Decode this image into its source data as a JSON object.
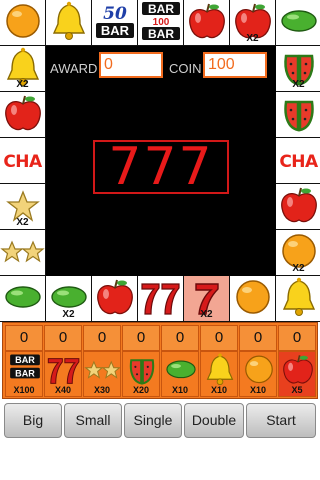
{
  "board": {
    "cells": [
      {
        "id": "c0",
        "icon": "orange",
        "mult": ""
      },
      {
        "id": "c1",
        "icon": "bell",
        "mult": ""
      },
      {
        "id": "c2",
        "icon": "bar-50",
        "mult": "",
        "label_top": "50",
        "label_bottom": "BAR"
      },
      {
        "id": "c3",
        "icon": "bar-100",
        "mult": "",
        "label_top": "BAR",
        "label_mid": "100",
        "label_bottom": "BAR"
      },
      {
        "id": "c4",
        "icon": "apple",
        "mult": ""
      },
      {
        "id": "c5",
        "icon": "apple",
        "mult": "X2"
      },
      {
        "id": "c6",
        "icon": "melon",
        "mult": ""
      },
      {
        "id": "c7",
        "icon": "watermelon",
        "mult": "X2"
      },
      {
        "id": "c8",
        "icon": "watermelon",
        "mult": ""
      },
      {
        "id": "c9",
        "icon": "cha",
        "mult": "",
        "text": "CHA"
      },
      {
        "id": "c10",
        "icon": "apple",
        "mult": ""
      },
      {
        "id": "c11",
        "icon": "orange",
        "mult": "X2"
      },
      {
        "id": "c12",
        "icon": "bell",
        "mult": ""
      },
      {
        "id": "c13",
        "icon": "orange",
        "mult": ""
      },
      {
        "id": "c14",
        "icon": "seven",
        "mult": "X2",
        "highlighted": true
      },
      {
        "id": "c15",
        "icon": "double-seven",
        "mult": ""
      },
      {
        "id": "c16",
        "icon": "apple",
        "mult": ""
      },
      {
        "id": "c17",
        "icon": "melon",
        "mult": "X2"
      },
      {
        "id": "c18",
        "icon": "melon",
        "mult": ""
      },
      {
        "id": "c19",
        "icon": "double-star",
        "mult": ""
      },
      {
        "id": "c20",
        "icon": "star",
        "mult": "X2"
      },
      {
        "id": "c21",
        "icon": "cha",
        "mult": "",
        "text": "CHA"
      },
      {
        "id": "c22",
        "icon": "apple",
        "mult": ""
      },
      {
        "id": "c23",
        "icon": "bell",
        "mult": "X2"
      }
    ]
  },
  "center": {
    "award_label": "AWARD",
    "award_value": "0",
    "coin_label": "COIN",
    "coin_value": "100",
    "display": "777"
  },
  "bets": [
    {
      "icon": "bar",
      "bet": "0",
      "payout": "X100",
      "label_top": "BAR",
      "label_bottom": "BAR"
    },
    {
      "icon": "double-seven",
      "bet": "0",
      "payout": "X40"
    },
    {
      "icon": "double-star",
      "bet": "0",
      "payout": "X30"
    },
    {
      "icon": "watermelon",
      "bet": "0",
      "payout": "X20"
    },
    {
      "icon": "melon",
      "bet": "0",
      "payout": "X10"
    },
    {
      "icon": "bell",
      "bet": "0",
      "payout": "X10"
    },
    {
      "icon": "orange",
      "bet": "0",
      "payout": "X10"
    },
    {
      "icon": "apple",
      "bet": "0",
      "payout": "X5",
      "highlighted": true
    }
  ],
  "buttons": [
    {
      "id": "big",
      "label": "Big"
    },
    {
      "id": "small",
      "label": "Small"
    },
    {
      "id": "single",
      "label": "Single"
    },
    {
      "id": "double",
      "label": "Double"
    },
    {
      "id": "start",
      "label": "Start"
    }
  ],
  "colors": {
    "accent": "#f26c1f",
    "highlight": "#f2a693",
    "seven_red": "#d61a1a",
    "display_red": "#e81a1a"
  }
}
